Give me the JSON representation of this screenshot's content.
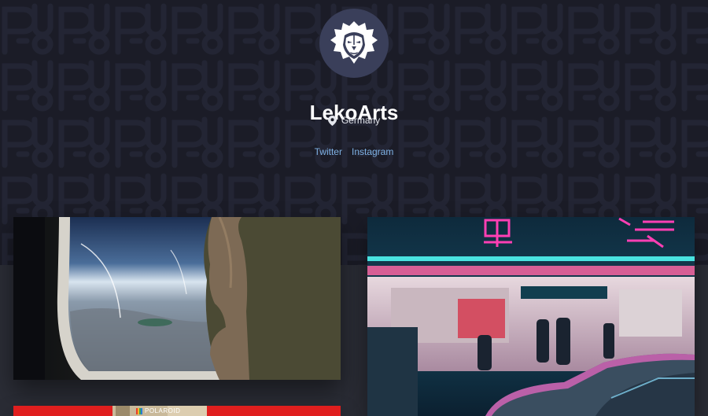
{
  "profile": {
    "name": "LekoArts",
    "location": "Germany",
    "avatar_icon": "lion-head-icon"
  },
  "social_links": [
    {
      "label": "Twitter"
    },
    {
      "label": "Instagram"
    }
  ],
  "projects": [
    {
      "image_subject": "airplane window with woman looking at earth"
    },
    {
      "image_subject": "neon-lit night street with parked cars"
    },
    {
      "image_subject": "polaroid camera on red background",
      "brand_text": "POLAROID"
    }
  ],
  "colors": {
    "hero_background": "#1b1d27",
    "page_background": "#2b2d36",
    "link": "#7fb2e5",
    "title": "#ffffff"
  }
}
